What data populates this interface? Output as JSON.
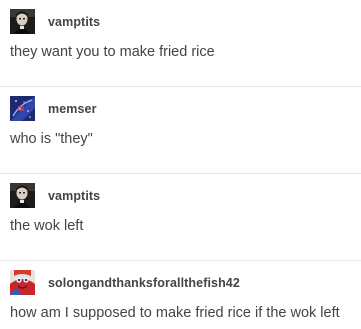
{
  "posts": [
    {
      "username": "vamptits",
      "text": "they want you to make fried rice",
      "avatar_icon": "dark-portrait-avatar-icon"
    },
    {
      "username": "memser",
      "text": "who is \"they\"",
      "avatar_icon": "blue-starry-avatar-icon"
    },
    {
      "username": "vamptits",
      "text": "the wok left",
      "avatar_icon": "dark-portrait-avatar-icon"
    },
    {
      "username": "solongandthanksforallthefish42",
      "text": "how am I supposed to make fried rice if the wok left",
      "avatar_icon": "red-cartoon-avatar-icon"
    }
  ],
  "colors": {
    "text": "#444444",
    "divider": "#e7e7e7",
    "background": "#ffffff"
  }
}
